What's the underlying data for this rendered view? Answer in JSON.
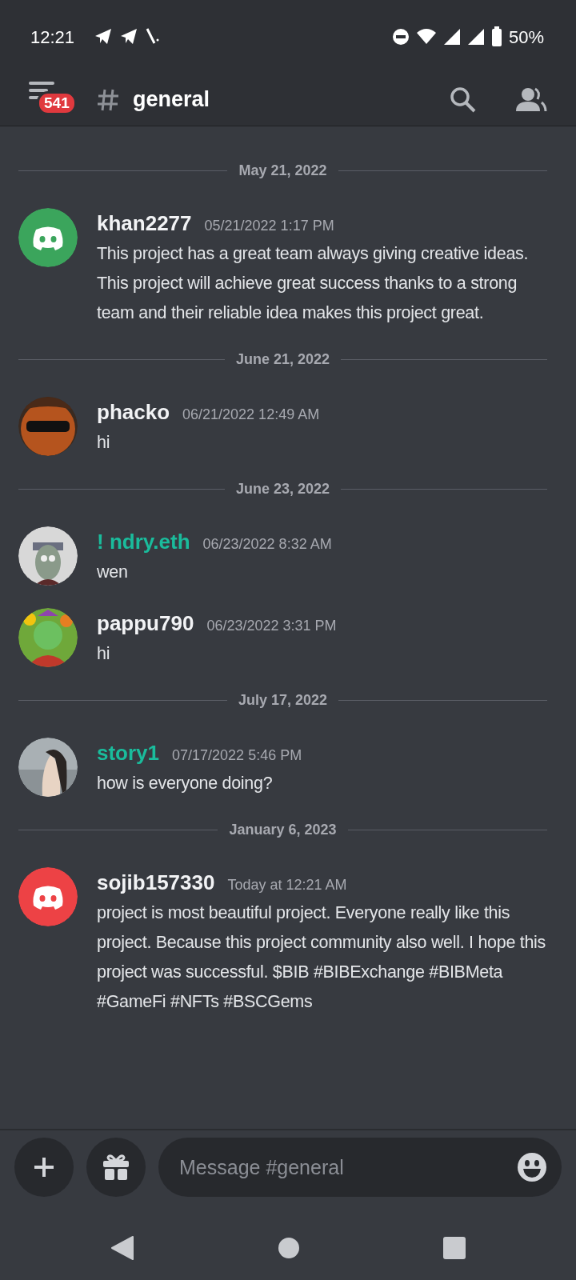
{
  "status_bar": {
    "time": "12:21",
    "battery": "50%"
  },
  "header": {
    "unread_count": "541",
    "channel": "general"
  },
  "messages": [
    {
      "kind": "divider",
      "date": "May 21, 2022"
    },
    {
      "kind": "message",
      "avatar": {
        "kind": "logo",
        "color": "#3ba55c"
      },
      "author": "khan2277",
      "color": "#f2f3f5",
      "time": "05/21/2022 1:17 PM",
      "text": "This project has a great team always giving creative ideas. This project will achieve great success thanks to a strong team and their reliable idea makes this project great."
    },
    {
      "kind": "divider",
      "date": "June 21, 2022"
    },
    {
      "kind": "message",
      "author": "phacko",
      "color": "#f2f3f5",
      "time": "06/21/2022 12:49 AM",
      "text": "hi"
    },
    {
      "kind": "divider",
      "date": "June 23, 2022"
    },
    {
      "kind": "message",
      "author": "! ndry.eth",
      "color": "#1abc9c",
      "time": "06/23/2022 8:32 AM",
      "text": "wen"
    },
    {
      "kind": "message",
      "author": "pappu790",
      "color": "#f2f3f5",
      "time": "06/23/2022 3:31 PM",
      "text": "hi"
    },
    {
      "kind": "divider",
      "date": "July 17, 2022"
    },
    {
      "kind": "message",
      "author": "story1",
      "color": "#1abc9c",
      "time": "07/17/2022 5:46 PM",
      "text": "how is everyone doing?"
    },
    {
      "kind": "divider",
      "date": "January 6, 2023"
    },
    {
      "kind": "message",
      "avatar": {
        "kind": "logo",
        "color": "#ed4245"
      },
      "author": "sojib157330",
      "color": "#f2f3f5",
      "time": "Today at 12:21 AM",
      "text": "project is most beautiful project. Everyone really like this project. Because this project community also well. I hope this project was successful. $BIB #BIBExchange #BIBMeta #GameFi #NFTs #BSCGems"
    }
  ],
  "composer": {
    "placeholder": "Message #general"
  }
}
